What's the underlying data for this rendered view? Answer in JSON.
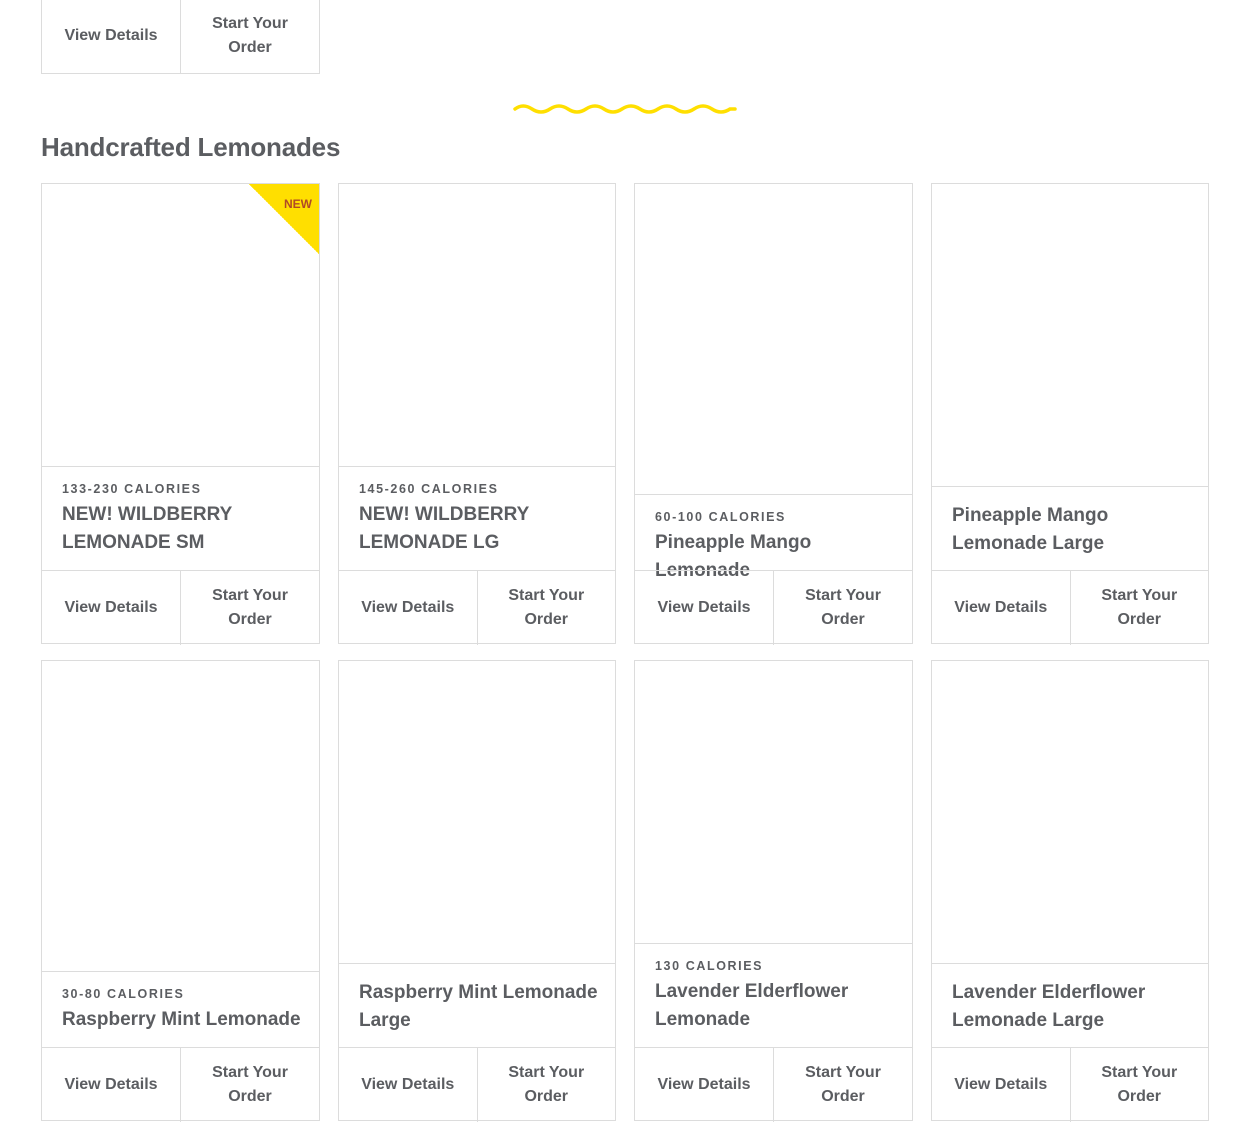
{
  "top_card": {
    "view_label": "View Details",
    "order_label": "Start Your Order"
  },
  "divider": {
    "name": "wavy-divider",
    "color": "#ffdf00"
  },
  "section": {
    "title": "Handcrafted Lemonades",
    "badge_color": "#ffdf00",
    "products": [
      {
        "calories": "133-230 CALORIES",
        "name": "NEW! WILDBERRY LEMONADE SM",
        "badge": "NEW",
        "view_label": "View Details",
        "order_label": "Start Your Order"
      },
      {
        "calories": "145-260 CALORIES",
        "name": "NEW! WILDBERRY LEMONADE LG",
        "view_label": "View Details",
        "order_label": "Start Your Order"
      },
      {
        "calories": "60-100 CALORIES",
        "name": "Pineapple Mango Lemonade",
        "view_label": "View Details",
        "order_label": "Start Your Order"
      },
      {
        "calories": "",
        "name": "Pineapple Mango Lemonade Large",
        "view_label": "View Details",
        "order_label": "Start Your Order"
      },
      {
        "calories": "30-80 CALORIES",
        "name": "Raspberry Mint Lemonade",
        "view_label": "View Details",
        "order_label": "Start Your Order"
      },
      {
        "calories": "",
        "name": "Raspberry Mint Lemonade Large",
        "view_label": "View Details",
        "order_label": "Start Your Order"
      },
      {
        "calories": "130 CALORIES",
        "name": "Lavender Elderflower Lemonade",
        "view_label": "View Details",
        "order_label": "Start Your Order"
      },
      {
        "calories": "",
        "name": "Lavender Elderflower Lemonade Large",
        "view_label": "View Details",
        "order_label": "Start Your Order"
      }
    ]
  }
}
